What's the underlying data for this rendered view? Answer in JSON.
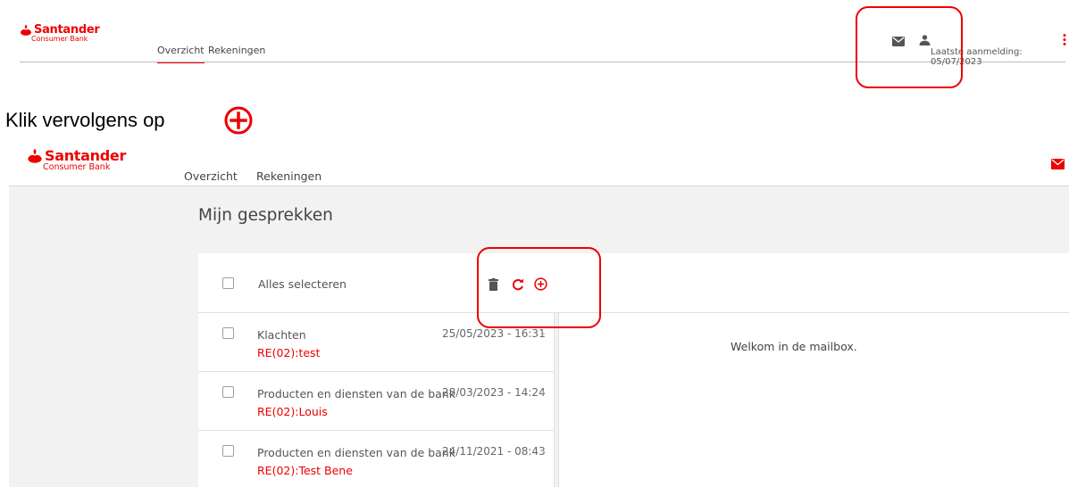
{
  "brand": {
    "name": "Santander",
    "sub": "Consumer Bank",
    "color": "#ec0000"
  },
  "top_screenshot": {
    "nav": [
      {
        "label": "Overzicht",
        "active": true
      },
      {
        "label": "Rekeningen",
        "active": false
      }
    ],
    "last_login": "Laatste aanmelding: 05/07/2023",
    "icons": [
      "mail-icon",
      "user-icon",
      "more-vertical-icon"
    ]
  },
  "instruction": {
    "text": "Klik vervolgens op",
    "icon": "add-circle-icon"
  },
  "mailbox_screenshot": {
    "nav": [
      {
        "label": "Overzicht"
      },
      {
        "label": "Rekeningen"
      }
    ],
    "page_title": "Mijn gesprekken",
    "select_all_label": "Alles selecteren",
    "toolbar_icons": [
      "trash-icon",
      "refresh-icon",
      "add-circle-icon"
    ],
    "welcome_text": "Welkom in de mailbox.",
    "conversations": [
      {
        "title": "Klachten",
        "subtitle": "RE(02):test",
        "date": "25/05/2023 - 16:31"
      },
      {
        "title": "Producten en diensten van de bank",
        "subtitle": "RE(02):Louis",
        "date": "28/03/2023 - 14:24"
      },
      {
        "title": "Producten en diensten van de bank",
        "subtitle": "RE(02):Test Bene",
        "date": "24/11/2021 - 08:43"
      }
    ]
  }
}
